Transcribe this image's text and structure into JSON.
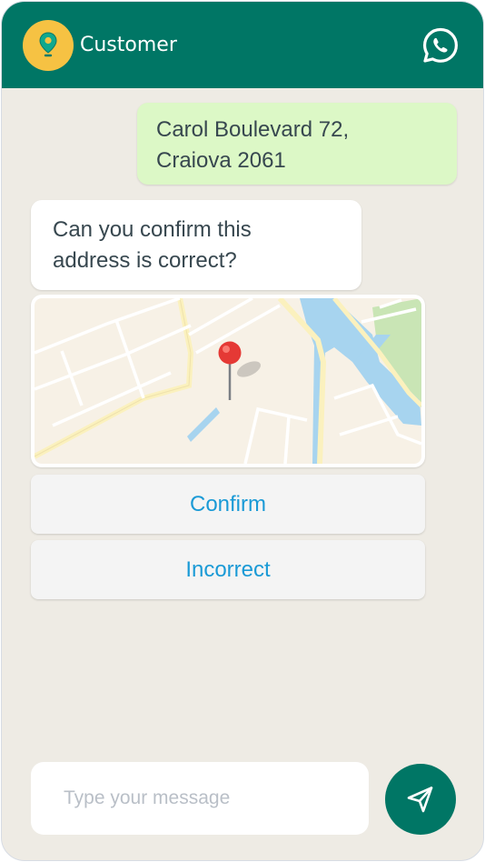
{
  "header": {
    "title": "Customer",
    "avatar_icon": "location-pin-icon",
    "right_icon": "whatsapp-icon",
    "background_color": "#007665",
    "avatar_color": "#f6c243"
  },
  "messages": [
    {
      "direction": "outgoing",
      "lines": [
        "Carol Boulevard 72,",
        "Craiova 2061"
      ],
      "color": "#dcf8c6"
    },
    {
      "direction": "incoming",
      "lines": [
        "Can you confirm this",
        "address is correct?"
      ],
      "color": "#ffffff"
    }
  ],
  "map": {
    "marker_icon": "map-pin-icon"
  },
  "quick_replies": {
    "confirm_label": "Confirm",
    "incorrect_label": "Incorrect",
    "text_color": "#1a9ad6"
  },
  "composer": {
    "placeholder": "Type your message",
    "send_icon": "send-icon"
  }
}
